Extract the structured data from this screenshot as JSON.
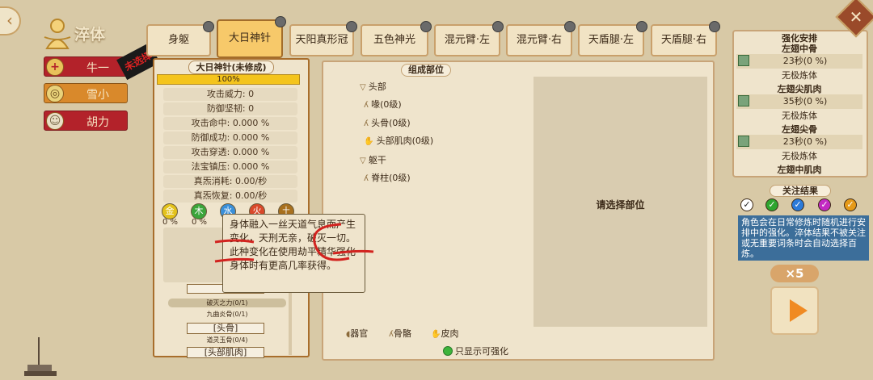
{
  "header": {
    "title": "淬体"
  },
  "characters": [
    {
      "name": "牛一",
      "icon": "plus-icon",
      "active": false
    },
    {
      "name": "雪小",
      "icon": "crest-icon",
      "active": true
    },
    {
      "name": "胡力",
      "icon": "person-icon",
      "active": false
    }
  ],
  "stamp": "未选择",
  "tabs": [
    "身躯",
    "大日神针",
    "天阳真形冠",
    "五色神光",
    "混元臂·左",
    "混元臂·右",
    "天盾腿·左",
    "天盾腿·右"
  ],
  "active_tab": "大日神针",
  "left_panel": {
    "title": "大日神针(未修成)",
    "progress_label": "100%",
    "progress": 1.0,
    "stats": [
      "攻击威力: 0",
      "防御坚韧: 0",
      "攻击命中: 0.000 %",
      "防御成功: 0.000 %",
      "攻击穿透: 0.000 %",
      "法宝镇压: 0.000 %",
      "真炁消耗: 0.00/秒",
      "真炁恢复: 0.00/秒"
    ],
    "elements": [
      {
        "char": "金",
        "pct": "0 %",
        "color": "#e3c21c"
      },
      {
        "char": "木",
        "pct": "0 %",
        "color": "#3aa53a"
      },
      {
        "char": "水",
        "pct": "",
        "color": "#3a8fd9"
      },
      {
        "char": "火",
        "pct": "",
        "color": "#d9482a"
      },
      {
        "char": "土",
        "pct": "",
        "color": "#a8701e"
      }
    ],
    "sub_items": [
      "破灭之力(0/1)",
      "九曲炎骨(0/1)",
      "[头骨]",
      "道灵玉骨(0/4)",
      "[头部肌肉]"
    ]
  },
  "tooltip": {
    "text": "身体融入一丝天道气息而产生变化，天刑无亲，破灭一切。此种变化在使用劫平精华强化身体时有更高几率获得。"
  },
  "mid_panel": {
    "title": "组成部位",
    "tree": [
      {
        "label": "头部",
        "type": "group",
        "level": 0
      },
      {
        "label": "喙(0级)",
        "type": "bone",
        "level": 1
      },
      {
        "label": "头骨(0级)",
        "type": "bone",
        "level": 1
      },
      {
        "label": "头部肌肉(0级)",
        "type": "skin",
        "level": 1
      },
      {
        "label": "躯干",
        "type": "group",
        "level": 0
      },
      {
        "label": "脊柱(0级)",
        "type": "bone",
        "level": 1
      }
    ],
    "select_prompt": "请选择部位",
    "legend": [
      {
        "icon": "organ-icon",
        "label": "器官"
      },
      {
        "icon": "bone-icon",
        "label": "骨骼"
      },
      {
        "icon": "skin-icon",
        "label": "皮肉"
      }
    ],
    "only_show_label": "只显示可强化"
  },
  "right_panel": {
    "title": "强化安排",
    "entries": [
      {
        "name": "左翅中骨",
        "value": "23秒(0 %)",
        "sub": "无极炼体"
      },
      {
        "name": "左翅尖肌肉",
        "value": "35秒(0 %)",
        "sub": "无极炼体"
      },
      {
        "name": "左翅尖骨",
        "value": "23秒(0 %)",
        "sub": "无极炼体"
      },
      {
        "name": "左翅中肌肉",
        "value": "",
        "sub": ""
      }
    ],
    "focus_title": "关注结果",
    "focus_colors": [
      "#ffffff",
      "#2fa52f",
      "#2a7ad9",
      "#c22ac2",
      "#e59a1a"
    ],
    "info_text": "角色会在日常修炼时随机进行安排中的强化。淬体结果不被关注或无重要词条时会自动选择百炼。",
    "multiplier": "×5"
  },
  "colors": {
    "accent": "#d9892b",
    "primary_red": "#b3222a",
    "panel": "#efe4cc"
  }
}
